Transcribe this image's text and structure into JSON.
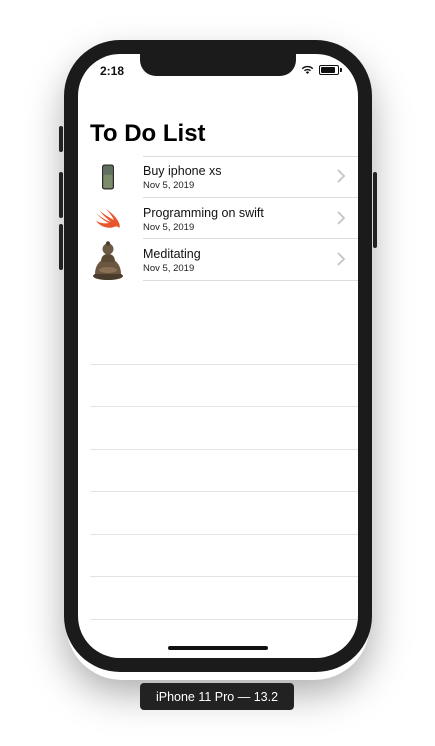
{
  "status_bar": {
    "time": "2:18"
  },
  "title": "To Do List",
  "items": [
    {
      "label": "Buy iphone xs",
      "date": "Nov 5, 2019",
      "icon": "iphone-icon"
    },
    {
      "label": "Programming on swift",
      "date": "Nov 5, 2019",
      "icon": "swift-logo-icon"
    },
    {
      "label": "Meditating",
      "date": "Nov 5, 2019",
      "icon": "buddha-statue-icon"
    }
  ],
  "device_label": "iPhone 11 Pro — 13.2"
}
